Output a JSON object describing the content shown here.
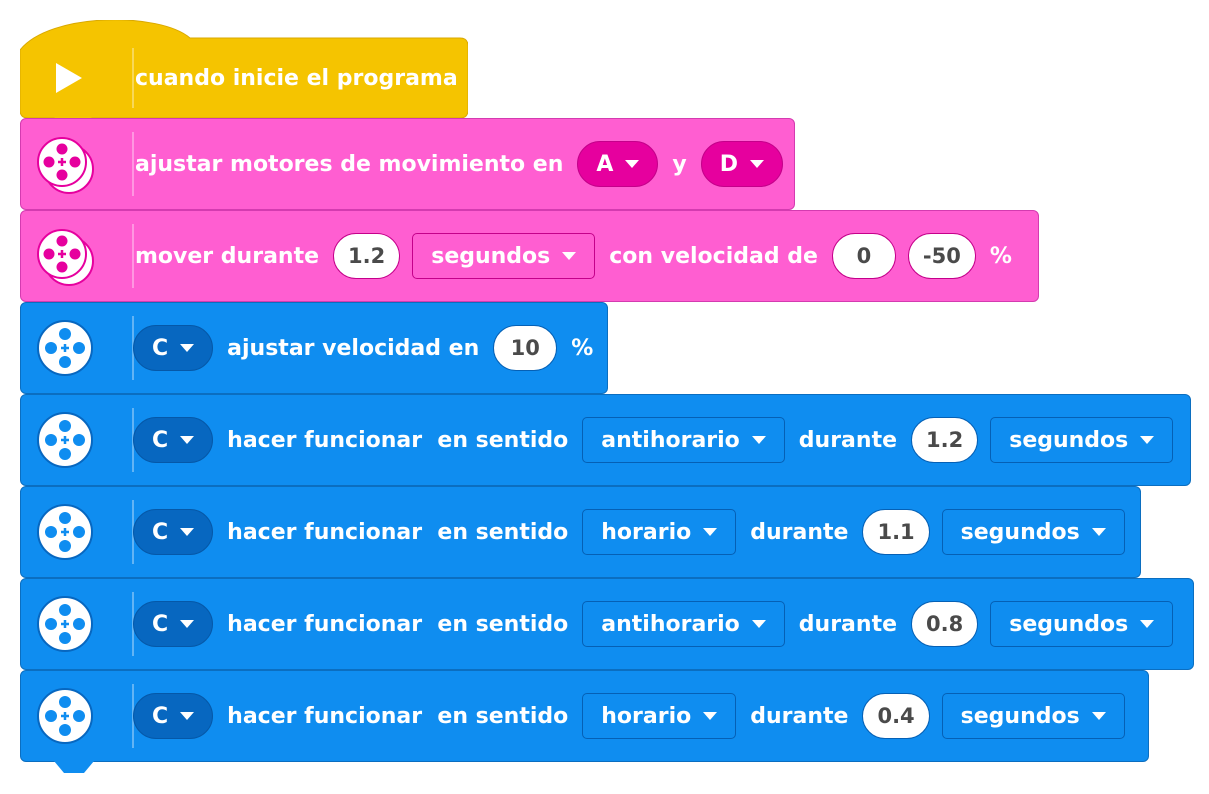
{
  "hat": {
    "label": "cuando inicie el programa"
  },
  "move_setup": {
    "label": "ajustar motores de movimiento en",
    "port_left": "A",
    "and_text": "y",
    "port_right": "D"
  },
  "move_for": {
    "label": "mover durante",
    "amount": "1.2",
    "unit": "segundos",
    "with_speed": "con velocidad de",
    "speed_left": "0",
    "speed_right": "-50",
    "percent": "%"
  },
  "set_speed": {
    "port": "C",
    "label": "ajustar velocidad en",
    "value": "10",
    "percent": "%"
  },
  "run_blocks": [
    {
      "port": "C",
      "label": "hacer funcionar  en sentido",
      "direction": "antihorario",
      "during": "durante",
      "amount": "1.2",
      "unit": "segundos"
    },
    {
      "port": "C",
      "label": "hacer funcionar  en sentido",
      "direction": "horario",
      "during": "durante",
      "amount": "1.1",
      "unit": "segundos"
    },
    {
      "port": "C",
      "label": "hacer funcionar  en sentido",
      "direction": "antihorario",
      "during": "durante",
      "amount": "0.8",
      "unit": "segundos"
    },
    {
      "port": "C",
      "label": "hacer funcionar  en sentido",
      "direction": "horario",
      "during": "durante",
      "amount": "0.4",
      "unit": "segundos"
    }
  ],
  "colors": {
    "event": "#f5c400",
    "movement": "#ff5ed1",
    "motor": "#0f8df0"
  }
}
